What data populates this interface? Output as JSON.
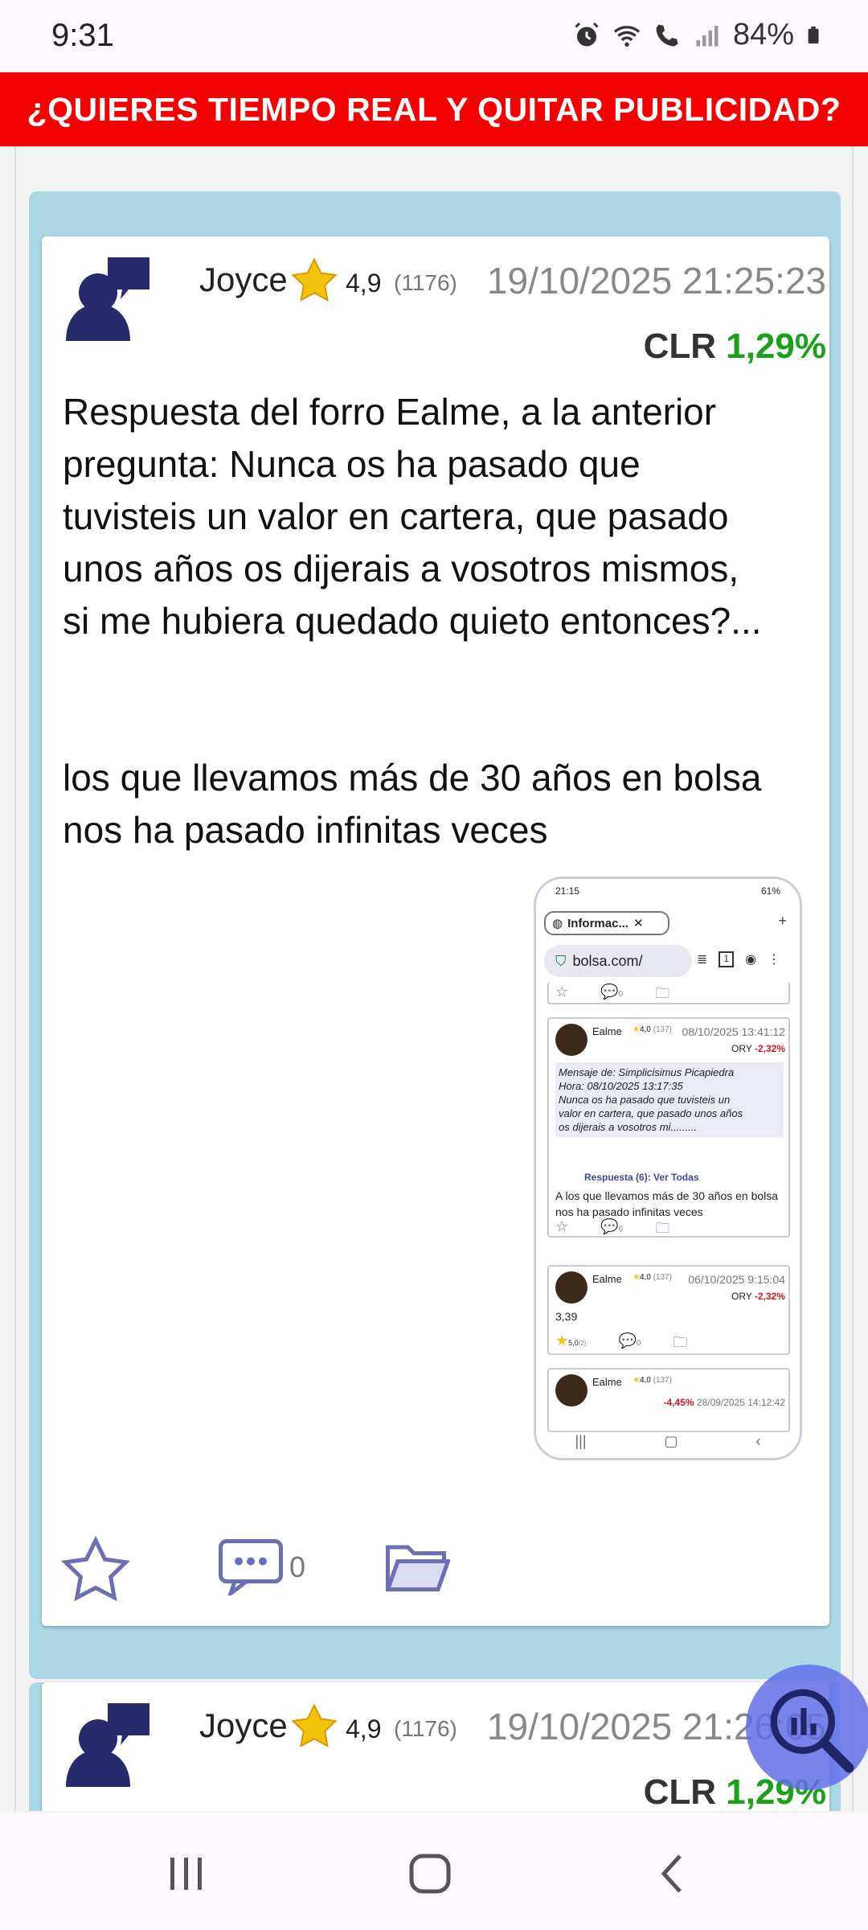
{
  "status_bar": {
    "time": "9:31",
    "battery": "84%",
    "icons": [
      "alarm-icon",
      "wifi-icon",
      "wifi-call-icon",
      "signal-icon",
      "battery-icon"
    ]
  },
  "banner": {
    "text": "¿QUIERES TIEMPO REAL Y QUITAR PUBLICIDAD?",
    "bg_color": "#f40000"
  },
  "posts": [
    {
      "user": "Joyce",
      "rating": "4,9",
      "rating_count": "(1176)",
      "date": "19/10/2025 21:25:23",
      "ticker": "CLR",
      "change": "1,29%",
      "body_lines": [
        "Respuesta del forro Ealme, a la anterior",
        "pregunta: Nunca os ha pasado que",
        "tuvisteis un valor en cartera, que pasado",
        "unos años os dijerais a vosotros mismos,",
        "si me hubiera quedado quieto entonces?...",
        "",
        "",
        "los que llevamos más de 30 años en bolsa",
        "nos ha pasado infinitas veces"
      ],
      "comments": "0"
    },
    {
      "user": "Joyce",
      "rating": "4,9",
      "rating_count": "(1176)",
      "date": "19/10/2025 21:26:05",
      "ticker": "CLR",
      "change": "1,29%"
    }
  ],
  "embedded_screenshot": {
    "time": "21:15",
    "battery": "61%",
    "tab_title": "Informac...",
    "url": "bolsa.com/",
    "tab_count": "1",
    "top_comment_count": "0",
    "card1": {
      "user": "Ealme",
      "rating": "4,0",
      "rating_count": "(137)",
      "date": "08/10/2025 13:41:12",
      "ticker": "ORY",
      "change": "-2,32%",
      "quote_lines": [
        "Mensaje de: Simplicisimus Picapiedra",
        "Hora: 08/10/2025 13:17:35",
        "Nunca os ha pasado que tuvisteis un",
        "valor en cartera, que pasado unos años",
        "os dijerais a vosotros mi........."
      ],
      "reply": "Respuesta (6): Ver Todas",
      "text": "A los que llevamos más de 30 años en bolsa nos ha pasado infinitas veces",
      "comments": "6"
    },
    "card2": {
      "user": "Ealme",
      "rating": "4,0",
      "rating_count": "(137)",
      "date": "06/10/2025 9:15:04",
      "ticker": "ORY",
      "change": "-2,32%",
      "text": "3,39",
      "star_rating": "5,0",
      "star_count": "(2)",
      "comments": "0"
    },
    "card3": {
      "user": "Ealme",
      "rating": "4,0",
      "rating_count": "(137)",
      "change": "-4,45%",
      "date": "28/09/2025 14:12:42"
    }
  },
  "colors": {
    "card_frame": "#acd8e6",
    "positive": "#1aa01a",
    "negative": "#d01818",
    "icon_blue": "#6c6fb3"
  }
}
